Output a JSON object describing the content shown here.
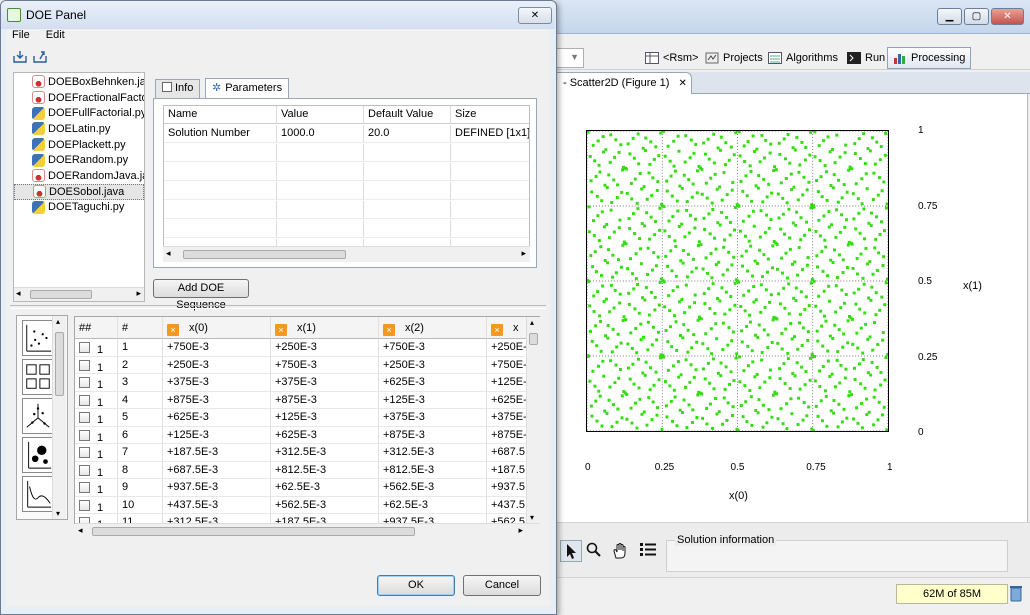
{
  "dialog": {
    "title": "DOE Panel",
    "menu": [
      "File",
      "Edit"
    ],
    "ok_label": "OK",
    "cancel_label": "Cancel",
    "add_sequence_label": "Add DOE Sequence"
  },
  "files": [
    {
      "name": "DOEBoxBehnken.java",
      "type": "java"
    },
    {
      "name": "DOEFractionalFactorial.java",
      "type": "java"
    },
    {
      "name": "DOEFullFactorial.py",
      "type": "py"
    },
    {
      "name": "DOELatin.py",
      "type": "py"
    },
    {
      "name": "DOEPlackett.py",
      "type": "py"
    },
    {
      "name": "DOERandom.py",
      "type": "py"
    },
    {
      "name": "DOERandomJava.java",
      "type": "java"
    },
    {
      "name": "DOESobol.java",
      "type": "java",
      "selected": true
    },
    {
      "name": "DOETaguchi.py",
      "type": "py"
    }
  ],
  "tabs": {
    "info": "Info",
    "parameters": "Parameters"
  },
  "param_table": {
    "headers": [
      "Name",
      "Value",
      "Default Value",
      "Size"
    ],
    "rows": [
      [
        "Solution Number",
        "1000.0",
        "20.0",
        "DEFINED [1x1]"
      ]
    ]
  },
  "sequence_table": {
    "headers": [
      "##",
      "#",
      "x(0)",
      "x(1)",
      "x(2)",
      "x"
    ],
    "rows": [
      [
        "1",
        "1",
        "+750E-3",
        "+250E-3",
        "+750E-3",
        "+250E-"
      ],
      [
        "1",
        "2",
        "+250E-3",
        "+750E-3",
        "+250E-3",
        "+750E-"
      ],
      [
        "1",
        "3",
        "+375E-3",
        "+375E-3",
        "+625E-3",
        "+125E-"
      ],
      [
        "1",
        "4",
        "+875E-3",
        "+875E-3",
        "+125E-3",
        "+625E-"
      ],
      [
        "1",
        "5",
        "+625E-3",
        "+125E-3",
        "+375E-3",
        "+375E-"
      ],
      [
        "1",
        "6",
        "+125E-3",
        "+625E-3",
        "+875E-3",
        "+875E-"
      ],
      [
        "1",
        "7",
        "+187.5E-3",
        "+312.5E-3",
        "+312.5E-3",
        "+687.5"
      ],
      [
        "1",
        "8",
        "+687.5E-3",
        "+812.5E-3",
        "+812.5E-3",
        "+187.5"
      ],
      [
        "1",
        "9",
        "+937.5E-3",
        "+62.5E-3",
        "+562.5E-3",
        "+937.5"
      ],
      [
        "1",
        "10",
        "+437.5E-3",
        "+562.5E-3",
        "+62.5E-3",
        "+437.5"
      ],
      [
        "1",
        "11",
        "+312.5E-3",
        "+187.5E-3",
        "+937.5E-3",
        "+562.5"
      ]
    ]
  },
  "main": {
    "perspectives": [
      "<Rsm>",
      "Projects",
      "Algorithms",
      "Run",
      "Processing"
    ],
    "active_perspective": "Processing",
    "editor_tab": "- Scatter2D (Figure 1)",
    "solution_info_label": "Solution information",
    "memory": "62M of 85M"
  },
  "chart_data": {
    "type": "scatter",
    "title": "",
    "xlabel": "x(0)",
    "ylabel": "x(1)",
    "xlim": [
      0,
      1
    ],
    "ylim": [
      0,
      1
    ],
    "x_ticks": [
      "0",
      "0.25",
      "0.5",
      "0.75",
      "1"
    ],
    "y_ticks": [
      "0",
      "0.25",
      "0.5",
      "0.75",
      "1"
    ],
    "grid": true,
    "point_color": "#33dd11",
    "n_points": 1000,
    "sequence": "Sobol"
  }
}
